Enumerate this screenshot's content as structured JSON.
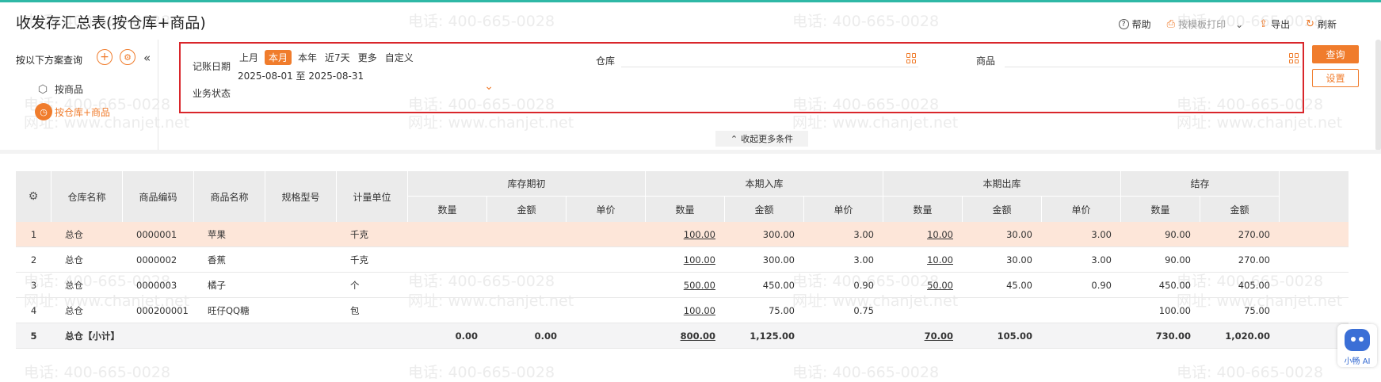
{
  "page": {
    "title": "收发存汇总表(按仓库+商品)"
  },
  "toolbar": {
    "help": "帮助",
    "print": "按模板打印",
    "export": "导出",
    "refresh": "刷新"
  },
  "watermark": {
    "phone": "电话: 400-665-0028",
    "site": "网址: www.chanjet.net"
  },
  "left_panel": {
    "title": "按以下方案查询",
    "items": [
      {
        "label": "按商品"
      },
      {
        "label": "按仓库+商品",
        "active": true
      }
    ]
  },
  "filters": {
    "date_label": "记账日期",
    "date_options": [
      "上月",
      "本月",
      "本年",
      "近7天",
      "更多",
      "自定义"
    ],
    "date_active": "本月",
    "date_range": "2025-08-01 至 2025-08-31",
    "warehouse_label": "仓库",
    "warehouse_value": "",
    "product_label": "商品",
    "product_value": "",
    "status_label": "业务状态",
    "status_value": "",
    "query_button": "查询",
    "settings_button": "设置",
    "collapse_label": "收起更多条件"
  },
  "table": {
    "headers": {
      "warehouse": "仓库名称",
      "code": "商品编码",
      "name": "商品名称",
      "spec": "规格型号",
      "unit": "计量单位",
      "opening": "库存期初",
      "in": "本期入库",
      "out": "本期出库",
      "closing": "结存",
      "qty": "数量",
      "amount": "金额",
      "price": "单价"
    },
    "rows": [
      {
        "no": "1",
        "warehouse": "总仓",
        "code": "0000001",
        "name": "苹果",
        "spec": "",
        "unit": "千克",
        "open_qty": "",
        "open_amt": "",
        "open_price": "",
        "in_qty": "100.00",
        "in_amt": "300.00",
        "in_price": "3.00",
        "out_qty": "10.00",
        "out_amt": "30.00",
        "out_price": "3.00",
        "close_qty": "90.00",
        "close_amt": "270.00"
      },
      {
        "no": "2",
        "warehouse": "总仓",
        "code": "0000002",
        "name": "香蕉",
        "spec": "",
        "unit": "千克",
        "open_qty": "",
        "open_amt": "",
        "open_price": "",
        "in_qty": "100.00",
        "in_amt": "300.00",
        "in_price": "3.00",
        "out_qty": "10.00",
        "out_amt": "30.00",
        "out_price": "3.00",
        "close_qty": "90.00",
        "close_amt": "270.00"
      },
      {
        "no": "3",
        "warehouse": "总仓",
        "code": "0000003",
        "name": "橘子",
        "spec": "",
        "unit": "个",
        "open_qty": "",
        "open_amt": "",
        "open_price": "",
        "in_qty": "500.00",
        "in_amt": "450.00",
        "in_price": "0.90",
        "out_qty": "50.00",
        "out_amt": "45.00",
        "out_price": "0.90",
        "close_qty": "450.00",
        "close_amt": "405.00"
      },
      {
        "no": "4",
        "warehouse": "总仓",
        "code": "000200001",
        "name": "旺仔QQ糖",
        "spec": "",
        "unit": "包",
        "open_qty": "",
        "open_amt": "",
        "open_price": "",
        "in_qty": "100.00",
        "in_amt": "75.00",
        "in_price": "0.75",
        "out_qty": "",
        "out_amt": "",
        "out_price": "",
        "close_qty": "100.00",
        "close_amt": "75.00"
      }
    ],
    "subtotal": {
      "no": "5",
      "label": "总仓【小计】",
      "open_qty": "0.00",
      "open_amt": "0.00",
      "in_qty": "800.00",
      "in_amt": "1,125.00",
      "out_qty": "70.00",
      "out_amt": "105.00",
      "close_qty": "730.00",
      "close_amt": "1,020.00"
    }
  },
  "assistant": {
    "label": "小畅 AI"
  }
}
